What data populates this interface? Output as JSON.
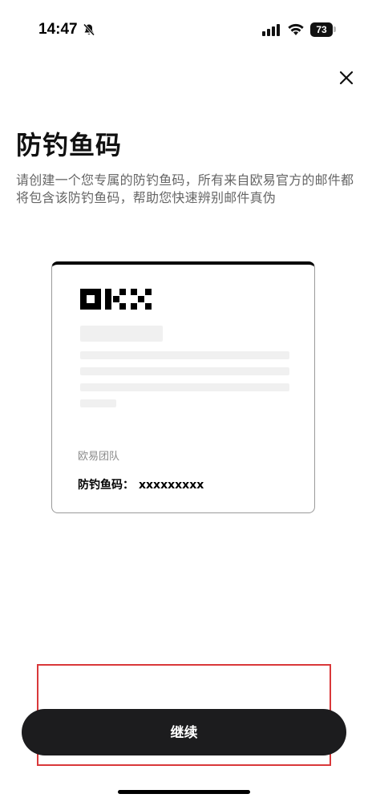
{
  "status_bar": {
    "time": "14:47",
    "battery_level": "73",
    "icons": [
      "bell-slash-icon",
      "signal-icon",
      "wifi-icon",
      "battery-icon"
    ]
  },
  "header": {
    "close_icon": "close-icon"
  },
  "content": {
    "title": "防钓鱼码",
    "description": "请创建一个您专属的防钓鱼码，所有来自欧易官方的邮件都将包含该防钓鱼码，帮助您快速辨别邮件真伪"
  },
  "preview_card": {
    "logo": "OKX",
    "team_label": "欧易团队",
    "code_label": "防钓鱼码：",
    "code_value": "xxxxxxxxx"
  },
  "footer": {
    "continue_label": "继续"
  },
  "colors": {
    "primary_button": "#1c1c1e",
    "highlight": "#d9383a",
    "description_text": "#666666"
  }
}
